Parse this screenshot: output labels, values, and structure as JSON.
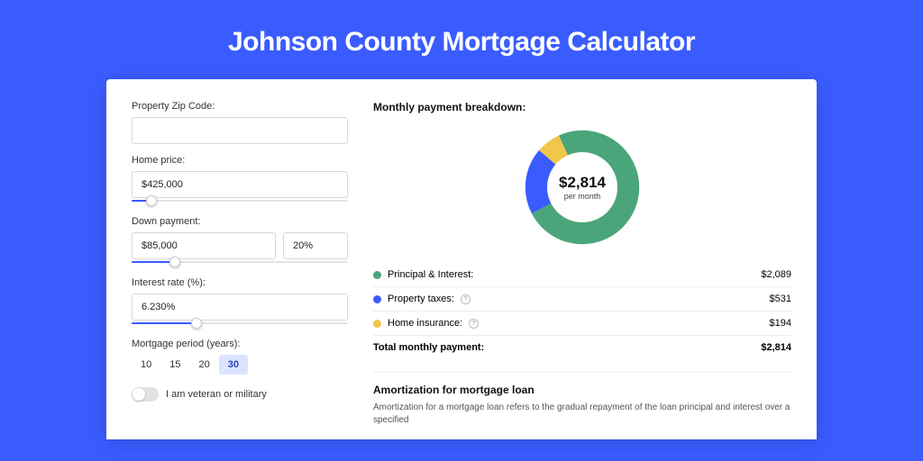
{
  "title": "Johnson County Mortgage Calculator",
  "form": {
    "zip_label": "Property Zip Code:",
    "zip_value": "",
    "home_price_label": "Home price:",
    "home_price_value": "$425,000",
    "down_payment_label": "Down payment:",
    "down_payment_value": "$85,000",
    "down_payment_pct": "20%",
    "interest_label": "Interest rate (%):",
    "interest_value": "6.230%",
    "period_label": "Mortgage period (years):",
    "periods": [
      "10",
      "15",
      "20",
      "30"
    ],
    "period_active_index": 3,
    "veteran_label": "I am veteran or military",
    "sliders": {
      "home_price_pct": 9,
      "down_payment_pct": 20,
      "interest_pct": 30
    }
  },
  "breakdown": {
    "title": "Monthly payment breakdown:",
    "total_value": "$2,814",
    "total_sub": "per month",
    "items": [
      {
        "label": "Principal & Interest:",
        "value": "$2,089",
        "color": "#4aa67a",
        "has_info": false
      },
      {
        "label": "Property taxes:",
        "value": "$531",
        "color": "#3a5cff",
        "has_info": true
      },
      {
        "label": "Home insurance:",
        "value": "$194",
        "color": "#f0c64b",
        "has_info": true
      }
    ],
    "total_row_label": "Total monthly payment:",
    "total_row_value": "$2,814"
  },
  "amort": {
    "title": "Amortization for mortgage loan",
    "body": "Amortization for a mortgage loan refers to the gradual repayment of the loan principal and interest over a specified"
  },
  "chart_data": {
    "type": "pie",
    "title": "Monthly payment breakdown",
    "categories": [
      "Principal & Interest",
      "Property taxes",
      "Home insurance"
    ],
    "values": [
      2089,
      531,
      194
    ],
    "colors": [
      "#4aa67a",
      "#3a5cff",
      "#f0c64b"
    ],
    "total": 2814,
    "total_label": "$2,814 per month"
  }
}
